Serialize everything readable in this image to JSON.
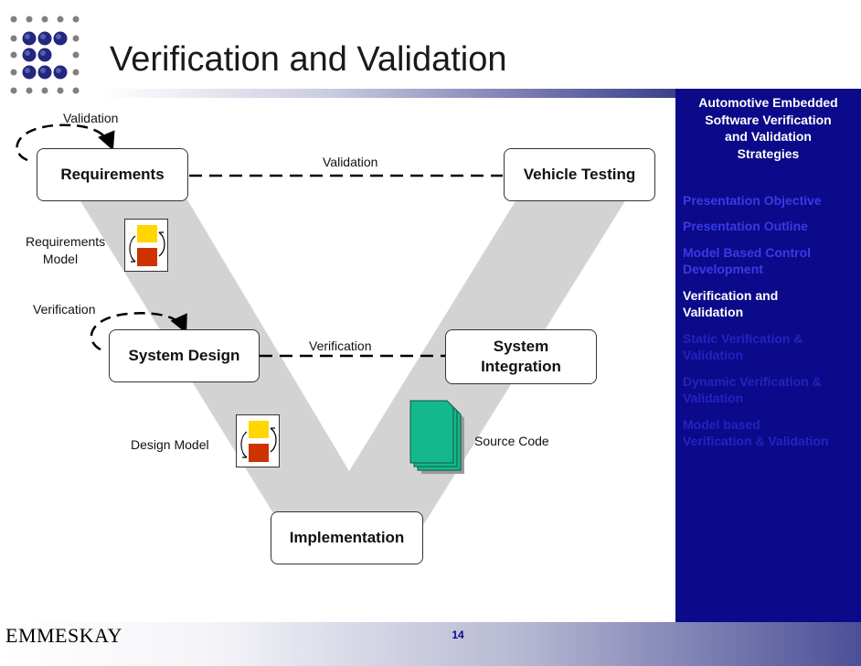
{
  "slide": {
    "title": "Verification and Validation",
    "page_number": "14",
    "logo_text": "EMMESKAY"
  },
  "sidebar": {
    "heading": [
      "Automotive Embedded",
      "Software Verification",
      "and Validation",
      "Strategies"
    ],
    "items": [
      {
        "lines": [
          "Presentation Objective"
        ],
        "state": "inactive"
      },
      {
        "lines": [
          "Presentation Outline"
        ],
        "state": "inactive"
      },
      {
        "lines": [
          "Model Based Control",
          "Development"
        ],
        "state": "inactive"
      },
      {
        "lines": [
          "Verification and",
          "Validation"
        ],
        "state": "active"
      },
      {
        "lines": [
          "Static Verification &",
          "Validation"
        ],
        "state": "faded"
      },
      {
        "lines": [
          "Dynamic Verification &",
          "Validation"
        ],
        "state": "faded"
      },
      {
        "lines": [
          "Model based",
          "Verification & Validation"
        ],
        "state": "faded"
      }
    ]
  },
  "diagram": {
    "boxes": {
      "requirements": "Requirements",
      "vehicle_testing": "Vehicle Testing",
      "system_design": "System Design",
      "system_integration_l1": "System",
      "system_integration_l2": "Integration",
      "implementation": "Implementation"
    },
    "labels": {
      "validation_loop": "Validation",
      "validation_link": "Validation",
      "requirements_model_l1": "Requirements",
      "requirements_model_l2": "Model",
      "verification_loop": "Verification",
      "verification_link": "Verification",
      "design_model": "Design Model",
      "source_code": "Source Code"
    },
    "icons": {
      "requirements_model": "model-cycle-icon",
      "design_model": "model-cycle-icon",
      "source_code": "document-stack-icon"
    }
  },
  "colors": {
    "sidebar_bg": "#0a0a8a",
    "sidebar_active": "#ffffff",
    "sidebar_inactive": "#3a3ae6",
    "v_shape": "#d3d3d3",
    "model_yellow": "#ffd600",
    "model_red": "#cc3300",
    "document_green": "#14b88a"
  }
}
